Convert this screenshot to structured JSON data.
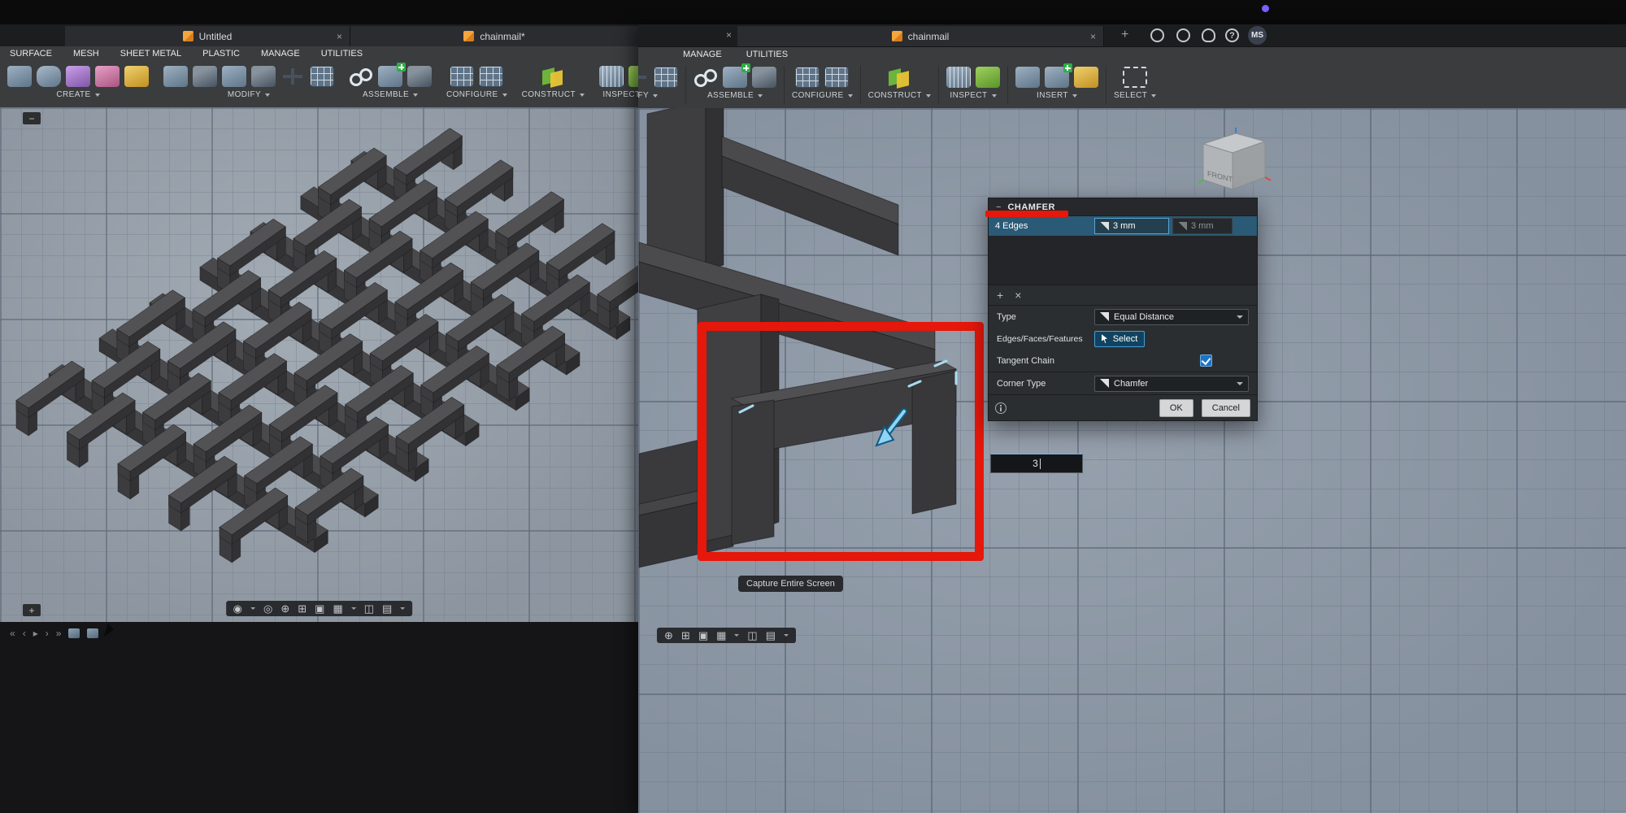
{
  "top": {
    "recording_dot_color": "#7b61ff"
  },
  "windowA": {
    "tabs": [
      {
        "label": "Untitled"
      },
      {
        "label": "chainmail*"
      }
    ],
    "tab_close": "×",
    "menus": [
      "SURFACE",
      "MESH",
      "SHEET METAL",
      "PLASTIC",
      "MANAGE",
      "UTILITIES"
    ],
    "groups": [
      {
        "label": "CREATE"
      },
      {
        "label": "MODIFY"
      },
      {
        "label": "ASSEMBLE"
      },
      {
        "label": "CONFIGURE"
      },
      {
        "label": "CONSTRUCT"
      },
      {
        "label": "INSPECT"
      }
    ],
    "browser_collapse": "−",
    "zoom_plus": "+",
    "nav": [
      {
        "glyph": "◉"
      },
      {
        "glyph": "◎"
      },
      {
        "glyph": "⊕"
      },
      {
        "glyph": "⊞"
      },
      {
        "glyph": "▣"
      },
      {
        "glyph": "▦"
      },
      {
        "glyph": "◫"
      },
      {
        "glyph": "▤"
      }
    ],
    "timeline": [
      {
        "glyph": "«"
      },
      {
        "glyph": "‹"
      },
      {
        "glyph": "▸"
      },
      {
        "glyph": "›"
      },
      {
        "glyph": "»"
      }
    ]
  },
  "windowB": {
    "leftover_tab_close": "×",
    "tab": {
      "label": "chainmail"
    },
    "tab_close": "×",
    "new_tab": "+",
    "titlebar": {
      "help": "?",
      "avatar": "MS"
    },
    "menus": [
      "MANAGE",
      "UTILITIES"
    ],
    "groups": [
      {
        "label": "MODIFY"
      },
      {
        "label": "ASSEMBLE"
      },
      {
        "label": "CONFIGURE"
      },
      {
        "label": "CONSTRUCT"
      },
      {
        "label": "INSPECT"
      },
      {
        "label": "INSERT"
      },
      {
        "label": "SELECT"
      }
    ],
    "viewcube": {
      "front_label": "FRONT"
    },
    "dialog": {
      "title": "CHAMFER",
      "collapse": "−",
      "row": {
        "edges": "4 Edges",
        "distance": "3 mm",
        "distance2": "3 mm"
      },
      "add": "+",
      "remove": "×",
      "type_label": "Type",
      "type_value": "Equal Distance",
      "edges_label": "Edges/Faces/Features",
      "select_button": "Select",
      "tangent_label": "Tangent Chain",
      "tangent_checked": true,
      "corner_label": "Corner Type",
      "corner_value": "Chamfer",
      "ok": "OK",
      "cancel": "Cancel"
    },
    "value_input": {
      "value": "3"
    },
    "capture_button": "Capture Entire Screen",
    "nav": [
      {
        "glyph": "⊕"
      },
      {
        "glyph": "⊞"
      },
      {
        "glyph": "▣"
      },
      {
        "glyph": "▦"
      },
      {
        "glyph": "◫"
      },
      {
        "glyph": "▤"
      }
    ]
  }
}
